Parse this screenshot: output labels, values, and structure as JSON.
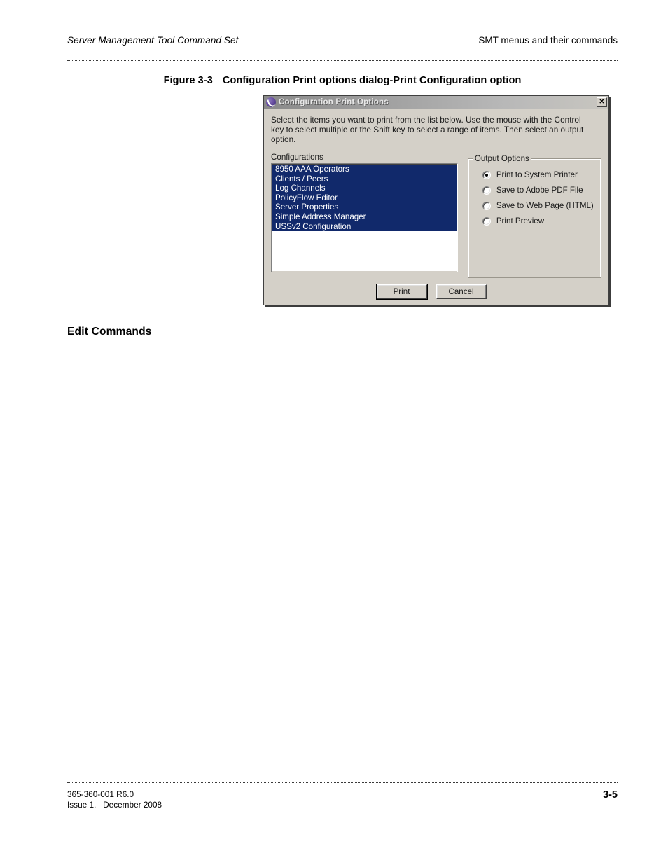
{
  "page_header": {
    "left": "Server Management Tool Command Set",
    "right": "SMT menus and their commands"
  },
  "figure": {
    "number": "Figure 3-3",
    "title": "Configuration Print options dialog-Print Configuration option"
  },
  "dialog": {
    "title": "Configuration Print Options",
    "icon": "app-logo-icon",
    "close_label": "✕",
    "instructions": "Select the items you want to print from the list below. Use the mouse with the Control key to select multiple or the Shift key to select a range of items. Then select an output option.",
    "configurations": {
      "label": "Configurations",
      "items": [
        {
          "label": "8950 AAA Operators",
          "selected": true
        },
        {
          "label": "Clients / Peers",
          "selected": true
        },
        {
          "label": "Log Channels",
          "selected": true
        },
        {
          "label": "PolicyFlow Editor",
          "selected": true
        },
        {
          "label": "Server Properties",
          "selected": true
        },
        {
          "label": "Simple Address Manager",
          "selected": true
        },
        {
          "label": "USSv2 Configuration",
          "selected": true
        }
      ]
    },
    "output_options": {
      "legend": "Output Options",
      "options": [
        {
          "label": "Print to System Printer",
          "checked": true
        },
        {
          "label": "Save to Adobe PDF File",
          "checked": false
        },
        {
          "label": "Save to Web Page (HTML)",
          "checked": false
        },
        {
          "label": "Print Preview",
          "checked": false
        }
      ]
    },
    "buttons": {
      "print": "Print",
      "cancel": "Cancel"
    },
    "colors": {
      "face": "#d4d0c8",
      "selection": "#11296b",
      "titlebar_start": "#8a8a8a",
      "titlebar_end": "#c8c6c0"
    }
  },
  "section_heading": "Edit Commands",
  "footer": {
    "doc_number": "365-360-001 R6.0",
    "issue": "Issue 1,   December 2008",
    "page_number": "3-5"
  }
}
